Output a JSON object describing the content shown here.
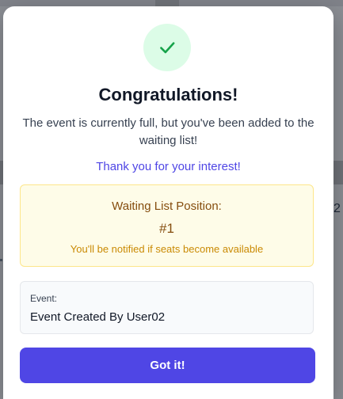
{
  "background": {
    "fragment_text": "2"
  },
  "modal": {
    "title": "Congratulations!",
    "message": "The event is currently full, but you've been added to the waiting list!",
    "thanks": "Thank you for your interest!",
    "waiting_list": {
      "label": "Waiting List Position:",
      "position": "#1",
      "note": "You'll be notified if seats become available"
    },
    "event": {
      "label": "Event:",
      "name": "Event Created By User02"
    },
    "button_label": "Got it!"
  },
  "colors": {
    "accent": "#4f46e5",
    "success": "#16a34a",
    "success_bg": "#dcfce7",
    "warning_bg": "#fefce8",
    "warning_text": "#854d0e"
  },
  "icons": {
    "success": "check-icon"
  }
}
